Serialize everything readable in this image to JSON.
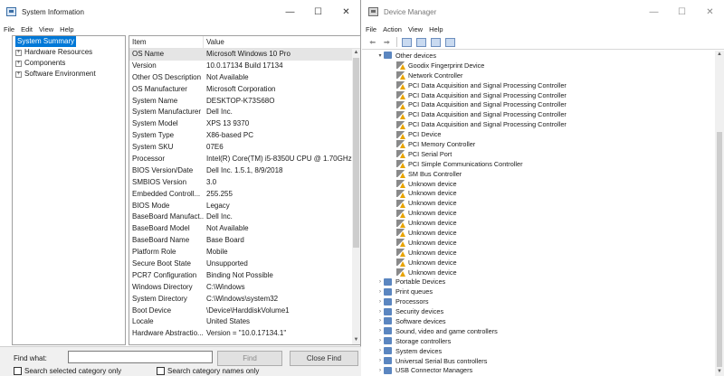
{
  "system_info": {
    "title": "System Information",
    "menu": [
      "File",
      "Edit",
      "View",
      "Help"
    ],
    "tree": [
      {
        "label": "System Summary",
        "selected": true,
        "expandable": false
      },
      {
        "label": "Hardware Resources",
        "selected": false,
        "expandable": true
      },
      {
        "label": "Components",
        "selected": false,
        "expandable": true
      },
      {
        "label": "Software Environment",
        "selected": false,
        "expandable": true
      }
    ],
    "columns": {
      "item": "Item",
      "value": "Value"
    },
    "rows": [
      {
        "item": "OS Name",
        "value": "Microsoft Windows 10 Pro"
      },
      {
        "item": "Version",
        "value": "10.0.17134 Build 17134"
      },
      {
        "item": "Other OS Description",
        "value": "Not Available"
      },
      {
        "item": "OS Manufacturer",
        "value": "Microsoft Corporation"
      },
      {
        "item": "System Name",
        "value": "DESKTOP-K73S68O"
      },
      {
        "item": "System Manufacturer",
        "value": "Dell Inc."
      },
      {
        "item": "System Model",
        "value": "XPS 13 9370"
      },
      {
        "item": "System Type",
        "value": "X86-based PC"
      },
      {
        "item": "System SKU",
        "value": "07E6"
      },
      {
        "item": "Processor",
        "value": "Intel(R) Core(TM) i5-8350U CPU @ 1.70GHz, 1"
      },
      {
        "item": "BIOS Version/Date",
        "value": "Dell Inc. 1.5.1, 8/9/2018"
      },
      {
        "item": "SMBIOS Version",
        "value": "3.0"
      },
      {
        "item": "Embedded Controll...",
        "value": "255.255"
      },
      {
        "item": "BIOS Mode",
        "value": "Legacy"
      },
      {
        "item": "BaseBoard Manufact...",
        "value": "Dell Inc."
      },
      {
        "item": "BaseBoard Model",
        "value": "Not Available"
      },
      {
        "item": "BaseBoard Name",
        "value": "Base Board"
      },
      {
        "item": "Platform Role",
        "value": "Mobile"
      },
      {
        "item": "Secure Boot State",
        "value": "Unsupported"
      },
      {
        "item": "PCR7 Configuration",
        "value": "Binding Not Possible"
      },
      {
        "item": "Windows Directory",
        "value": "C:\\Windows"
      },
      {
        "item": "System Directory",
        "value": "C:\\Windows\\system32"
      },
      {
        "item": "Boot Device",
        "value": "\\Device\\HarddiskVolume1"
      },
      {
        "item": "Locale",
        "value": "United States"
      },
      {
        "item": "Hardware Abstractio...",
        "value": "Version = \"10.0.17134.1\""
      }
    ],
    "find": {
      "label": "Find what:",
      "value": "",
      "find_button": "Find",
      "close_button": "Close Find",
      "check_selected": "Search selected category only",
      "check_names": "Search category names only"
    }
  },
  "device_manager": {
    "title": "Device Manager",
    "menu": [
      "File",
      "Action",
      "View",
      "Help"
    ],
    "toolbar_icons": [
      "back-arrow",
      "forward-arrow",
      "properties",
      "help",
      "update-driver",
      "monitor"
    ],
    "tree": [
      {
        "label": "Other devices",
        "level": 0,
        "expanded": true,
        "icon": "other-devices"
      },
      {
        "label": "Goodix Fingerprint Device",
        "level": 1,
        "icon": "warning-device"
      },
      {
        "label": "Network Controller",
        "level": 1,
        "icon": "warning-device"
      },
      {
        "label": "PCI Data Acquisition and Signal Processing Controller",
        "level": 1,
        "icon": "warning-device"
      },
      {
        "label": "PCI Data Acquisition and Signal Processing Controller",
        "level": 1,
        "icon": "warning-device"
      },
      {
        "label": "PCI Data Acquisition and Signal Processing Controller",
        "level": 1,
        "icon": "warning-device"
      },
      {
        "label": "PCI Data Acquisition and Signal Processing Controller",
        "level": 1,
        "icon": "warning-device"
      },
      {
        "label": "PCI Data Acquisition and Signal Processing Controller",
        "level": 1,
        "icon": "warning-device"
      },
      {
        "label": "PCI Device",
        "level": 1,
        "icon": "warning-device"
      },
      {
        "label": "PCI Memory Controller",
        "level": 1,
        "icon": "warning-device"
      },
      {
        "label": "PCI Serial Port",
        "level": 1,
        "icon": "warning-device"
      },
      {
        "label": "PCI Simple Communications Controller",
        "level": 1,
        "icon": "warning-device"
      },
      {
        "label": "SM Bus Controller",
        "level": 1,
        "icon": "warning-device"
      },
      {
        "label": "Unknown device",
        "level": 1,
        "icon": "warning-device"
      },
      {
        "label": "Unknown device",
        "level": 1,
        "icon": "warning-device"
      },
      {
        "label": "Unknown device",
        "level": 1,
        "icon": "warning-device"
      },
      {
        "label": "Unknown device",
        "level": 1,
        "icon": "warning-device"
      },
      {
        "label": "Unknown device",
        "level": 1,
        "icon": "warning-device"
      },
      {
        "label": "Unknown device",
        "level": 1,
        "icon": "warning-device"
      },
      {
        "label": "Unknown device",
        "level": 1,
        "icon": "warning-device"
      },
      {
        "label": "Unknown device",
        "level": 1,
        "icon": "warning-device"
      },
      {
        "label": "Unknown device",
        "level": 1,
        "icon": "warning-device"
      },
      {
        "label": "Unknown device",
        "level": 1,
        "icon": "warning-device"
      },
      {
        "label": "Portable Devices",
        "level": 0,
        "expanded": false,
        "icon": "portable-devices"
      },
      {
        "label": "Print queues",
        "level": 0,
        "expanded": false,
        "icon": "printer"
      },
      {
        "label": "Processors",
        "level": 0,
        "expanded": false,
        "icon": "processor"
      },
      {
        "label": "Security devices",
        "level": 0,
        "expanded": false,
        "icon": "security-device"
      },
      {
        "label": "Software devices",
        "level": 0,
        "expanded": false,
        "icon": "software-device"
      },
      {
        "label": "Sound, video and game controllers",
        "level": 0,
        "expanded": false,
        "icon": "speaker"
      },
      {
        "label": "Storage controllers",
        "level": 0,
        "expanded": false,
        "icon": "storage"
      },
      {
        "label": "System devices",
        "level": 0,
        "expanded": false,
        "icon": "system-devices"
      },
      {
        "label": "Universal Serial Bus controllers",
        "level": 0,
        "expanded": false,
        "icon": "usb"
      },
      {
        "label": "USB Connector Managers",
        "level": 0,
        "expanded": false,
        "icon": "usb-connector"
      }
    ]
  }
}
